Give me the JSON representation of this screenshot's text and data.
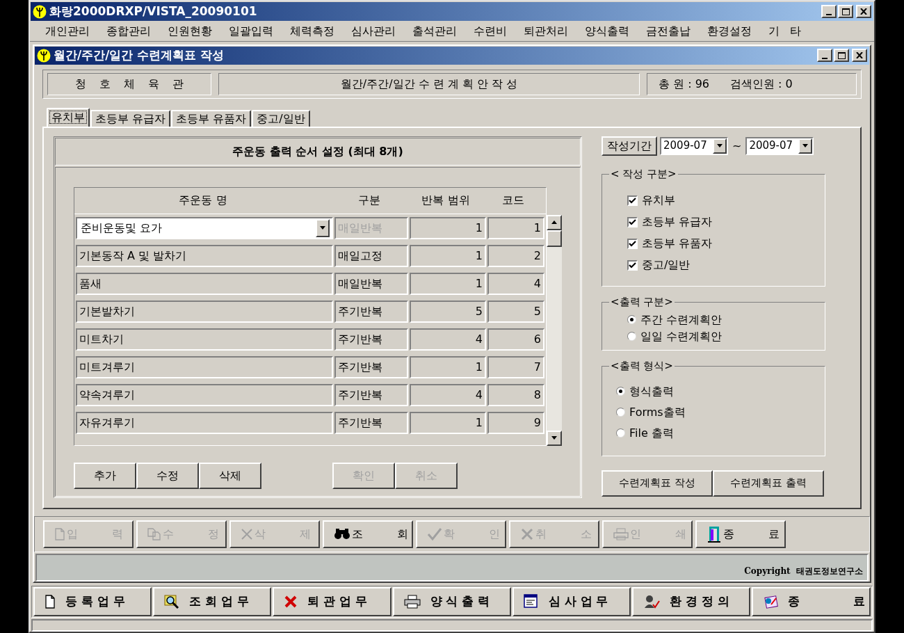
{
  "window": {
    "title": "화랑2000DRXP/VISTA_20090101"
  },
  "menu": [
    "개인관리",
    "종합관리",
    "인원현황",
    "일괄입력",
    "체력측정",
    "심사관리",
    "출석관리",
    "수련비",
    "퇴관처리",
    "양식출력",
    "금전출납",
    "환경설정",
    "기 타"
  ],
  "child_window": {
    "title": "월간/주간/일간 수련계획표 작성"
  },
  "header": {
    "gym": "청 호 체 육 관",
    "subtitle": "월간/주간/일간 수 련 계 획 안 작 성",
    "total": "총 원 : 96",
    "searched": "검색인원 : 0"
  },
  "tabs": [
    {
      "label": "유치부",
      "selected": true
    },
    {
      "label": "초등부 유급자",
      "selected": false
    },
    {
      "label": "초등부 유품자",
      "selected": false
    },
    {
      "label": "중고/일반",
      "selected": false
    }
  ],
  "exercise_panel": {
    "title": "주운동 출력 순서 설정 (최대 8개)",
    "columns": [
      "주운동 명",
      "구분",
      "반복 범위",
      "코드"
    ],
    "rows": [
      {
        "kind": "combo",
        "name": "준비운동및 요가",
        "category": "매일반복",
        "range": "1",
        "code": "1"
      },
      {
        "kind": "text",
        "name": "기본동작 A 및 발차기",
        "category": "매일고정",
        "range": "1",
        "code": "2"
      },
      {
        "kind": "text",
        "name": "품새",
        "category": "매일반복",
        "range": "1",
        "code": "4"
      },
      {
        "kind": "text",
        "name": "기본발차기",
        "category": "주기반복",
        "range": "5",
        "code": "5"
      },
      {
        "kind": "text",
        "name": "미트차기",
        "category": "주기반복",
        "range": "4",
        "code": "6"
      },
      {
        "kind": "text",
        "name": "미트겨루기",
        "category": "주기반복",
        "range": "1",
        "code": "7"
      },
      {
        "kind": "text",
        "name": "약속겨루기",
        "category": "주기반복",
        "range": "4",
        "code": "8"
      },
      {
        "kind": "text",
        "name": "자유겨루기",
        "category": "주기반복",
        "range": "1",
        "code": "9"
      }
    ],
    "edit_buttons": [
      {
        "label": "추가",
        "disabled": false
      },
      {
        "label": "수정",
        "disabled": false
      },
      {
        "label": "삭제",
        "disabled": false
      }
    ],
    "confirm_buttons": [
      {
        "label": "확인",
        "disabled": true
      },
      {
        "label": "취소",
        "disabled": true
      }
    ]
  },
  "period": {
    "label": "작성기간",
    "from": "2009-07",
    "separator": "~",
    "to": "2009-07"
  },
  "write_section": {
    "title": "< 작성 구분>",
    "items": [
      {
        "label": "유치부",
        "checked": true
      },
      {
        "label": "초등부 유급자",
        "checked": true
      },
      {
        "label": "초등부 유품자",
        "checked": true
      },
      {
        "label": "중고/일반",
        "checked": true
      }
    ]
  },
  "output_section": {
    "title": "<출력 구분>",
    "options": [
      {
        "label": "주간 수련계획안",
        "selected": true
      },
      {
        "label": "일일 수련계획안",
        "selected": false
      }
    ]
  },
  "format_section": {
    "title": "<출력 형식>",
    "options": [
      {
        "label": "형식출력",
        "selected": true
      },
      {
        "label": "Forms출력",
        "selected": false
      },
      {
        "label": "File 출력",
        "selected": false
      }
    ]
  },
  "action_buttons": [
    "수련계획표 작성",
    "수련계획표 출력"
  ],
  "toolbar": [
    {
      "label": "입 력",
      "disabled": true
    },
    {
      "label": "수 정",
      "disabled": true
    },
    {
      "label": "삭 제",
      "disabled": true
    },
    {
      "label": "조 회",
      "disabled": false
    },
    {
      "label": "확 인",
      "disabled": true
    },
    {
      "label": "취 소",
      "disabled": true
    },
    {
      "label": "인 쇄",
      "disabled": true
    },
    {
      "label": "종 료",
      "disabled": false
    }
  ],
  "copyright": "Copyright  태권도정보연구소",
  "taskbar": [
    "등 록 업 무",
    "조 회 업 무",
    "퇴 관 업 무",
    "양 식 출 력",
    "심 사 업 무",
    "환 경 정 의",
    "종             료"
  ]
}
